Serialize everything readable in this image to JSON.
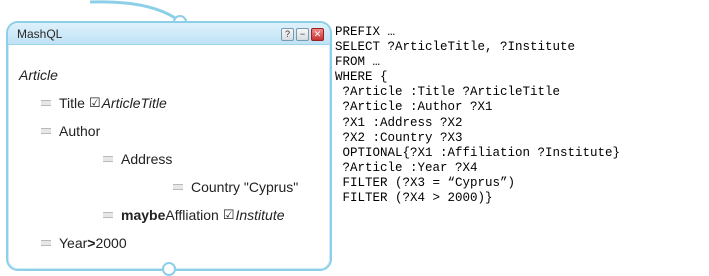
{
  "panel": {
    "title": "MashQL",
    "controls": {
      "help": "?",
      "minimize": "−",
      "close": "✕"
    }
  },
  "tree": {
    "root": "Article",
    "title_label": "Title ",
    "title_checkbox": "☑",
    "title_var": "ArticleTitle",
    "author": "Author",
    "address": "Address",
    "country": "Country \"Cyprus\"",
    "maybe": "maybe",
    "affiliation_label": " Affliation ",
    "affiliation_checkbox": "☑",
    "affiliation_var": "Institute",
    "year_prefix": "Year ",
    "year_op": ">",
    "year_value": " 2000"
  },
  "code": [
    "PREFIX …",
    "SELECT ?ArticleTitle, ?Institute",
    "FROM …",
    "WHERE {",
    " ?Article :Title ?ArticleTitle",
    " ?Article :Author ?X1",
    " ?X1 :Address ?X2",
    " ?X2 :Country ?X3",
    " OPTIONAL{?X1 :Affiliation ?Institute}",
    " ?Article :Year ?X4",
    " FILTER (?X3 = “Cyprus”)",
    " FILTER (?X4 > 2000)}"
  ]
}
